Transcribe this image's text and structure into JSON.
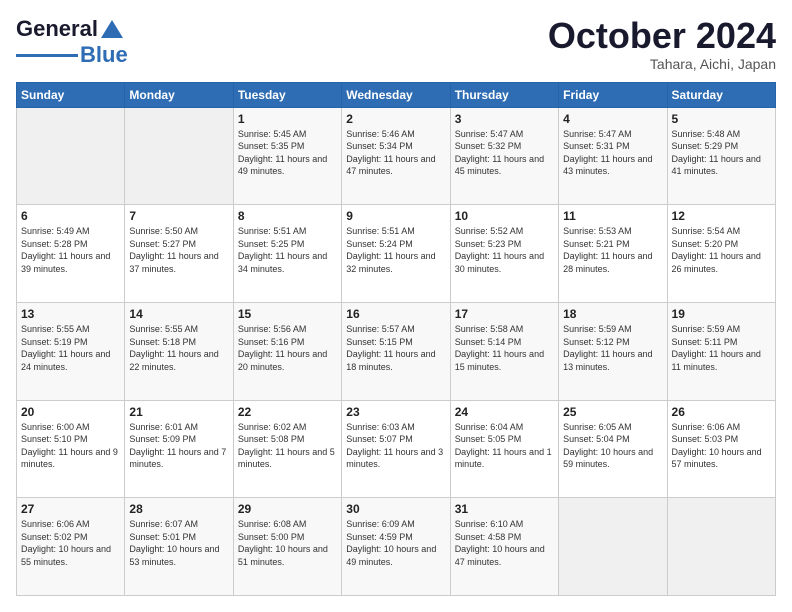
{
  "header": {
    "logo_general": "General",
    "logo_blue": "Blue",
    "month_title": "October 2024",
    "subtitle": "Tahara, Aichi, Japan"
  },
  "days_of_week": [
    "Sunday",
    "Monday",
    "Tuesday",
    "Wednesday",
    "Thursday",
    "Friday",
    "Saturday"
  ],
  "weeks": [
    [
      {
        "day": "",
        "info": ""
      },
      {
        "day": "",
        "info": ""
      },
      {
        "day": "1",
        "info": "Sunrise: 5:45 AM\nSunset: 5:35 PM\nDaylight: 11 hours and 49 minutes."
      },
      {
        "day": "2",
        "info": "Sunrise: 5:46 AM\nSunset: 5:34 PM\nDaylight: 11 hours and 47 minutes."
      },
      {
        "day": "3",
        "info": "Sunrise: 5:47 AM\nSunset: 5:32 PM\nDaylight: 11 hours and 45 minutes."
      },
      {
        "day": "4",
        "info": "Sunrise: 5:47 AM\nSunset: 5:31 PM\nDaylight: 11 hours and 43 minutes."
      },
      {
        "day": "5",
        "info": "Sunrise: 5:48 AM\nSunset: 5:29 PM\nDaylight: 11 hours and 41 minutes."
      }
    ],
    [
      {
        "day": "6",
        "info": "Sunrise: 5:49 AM\nSunset: 5:28 PM\nDaylight: 11 hours and 39 minutes."
      },
      {
        "day": "7",
        "info": "Sunrise: 5:50 AM\nSunset: 5:27 PM\nDaylight: 11 hours and 37 minutes."
      },
      {
        "day": "8",
        "info": "Sunrise: 5:51 AM\nSunset: 5:25 PM\nDaylight: 11 hours and 34 minutes."
      },
      {
        "day": "9",
        "info": "Sunrise: 5:51 AM\nSunset: 5:24 PM\nDaylight: 11 hours and 32 minutes."
      },
      {
        "day": "10",
        "info": "Sunrise: 5:52 AM\nSunset: 5:23 PM\nDaylight: 11 hours and 30 minutes."
      },
      {
        "day": "11",
        "info": "Sunrise: 5:53 AM\nSunset: 5:21 PM\nDaylight: 11 hours and 28 minutes."
      },
      {
        "day": "12",
        "info": "Sunrise: 5:54 AM\nSunset: 5:20 PM\nDaylight: 11 hours and 26 minutes."
      }
    ],
    [
      {
        "day": "13",
        "info": "Sunrise: 5:55 AM\nSunset: 5:19 PM\nDaylight: 11 hours and 24 minutes."
      },
      {
        "day": "14",
        "info": "Sunrise: 5:55 AM\nSunset: 5:18 PM\nDaylight: 11 hours and 22 minutes."
      },
      {
        "day": "15",
        "info": "Sunrise: 5:56 AM\nSunset: 5:16 PM\nDaylight: 11 hours and 20 minutes."
      },
      {
        "day": "16",
        "info": "Sunrise: 5:57 AM\nSunset: 5:15 PM\nDaylight: 11 hours and 18 minutes."
      },
      {
        "day": "17",
        "info": "Sunrise: 5:58 AM\nSunset: 5:14 PM\nDaylight: 11 hours and 15 minutes."
      },
      {
        "day": "18",
        "info": "Sunrise: 5:59 AM\nSunset: 5:12 PM\nDaylight: 11 hours and 13 minutes."
      },
      {
        "day": "19",
        "info": "Sunrise: 5:59 AM\nSunset: 5:11 PM\nDaylight: 11 hours and 11 minutes."
      }
    ],
    [
      {
        "day": "20",
        "info": "Sunrise: 6:00 AM\nSunset: 5:10 PM\nDaylight: 11 hours and 9 minutes."
      },
      {
        "day": "21",
        "info": "Sunrise: 6:01 AM\nSunset: 5:09 PM\nDaylight: 11 hours and 7 minutes."
      },
      {
        "day": "22",
        "info": "Sunrise: 6:02 AM\nSunset: 5:08 PM\nDaylight: 11 hours and 5 minutes."
      },
      {
        "day": "23",
        "info": "Sunrise: 6:03 AM\nSunset: 5:07 PM\nDaylight: 11 hours and 3 minutes."
      },
      {
        "day": "24",
        "info": "Sunrise: 6:04 AM\nSunset: 5:05 PM\nDaylight: 11 hours and 1 minute."
      },
      {
        "day": "25",
        "info": "Sunrise: 6:05 AM\nSunset: 5:04 PM\nDaylight: 10 hours and 59 minutes."
      },
      {
        "day": "26",
        "info": "Sunrise: 6:06 AM\nSunset: 5:03 PM\nDaylight: 10 hours and 57 minutes."
      }
    ],
    [
      {
        "day": "27",
        "info": "Sunrise: 6:06 AM\nSunset: 5:02 PM\nDaylight: 10 hours and 55 minutes."
      },
      {
        "day": "28",
        "info": "Sunrise: 6:07 AM\nSunset: 5:01 PM\nDaylight: 10 hours and 53 minutes."
      },
      {
        "day": "29",
        "info": "Sunrise: 6:08 AM\nSunset: 5:00 PM\nDaylight: 10 hours and 51 minutes."
      },
      {
        "day": "30",
        "info": "Sunrise: 6:09 AM\nSunset: 4:59 PM\nDaylight: 10 hours and 49 minutes."
      },
      {
        "day": "31",
        "info": "Sunrise: 6:10 AM\nSunset: 4:58 PM\nDaylight: 10 hours and 47 minutes."
      },
      {
        "day": "",
        "info": ""
      },
      {
        "day": "",
        "info": ""
      }
    ]
  ]
}
